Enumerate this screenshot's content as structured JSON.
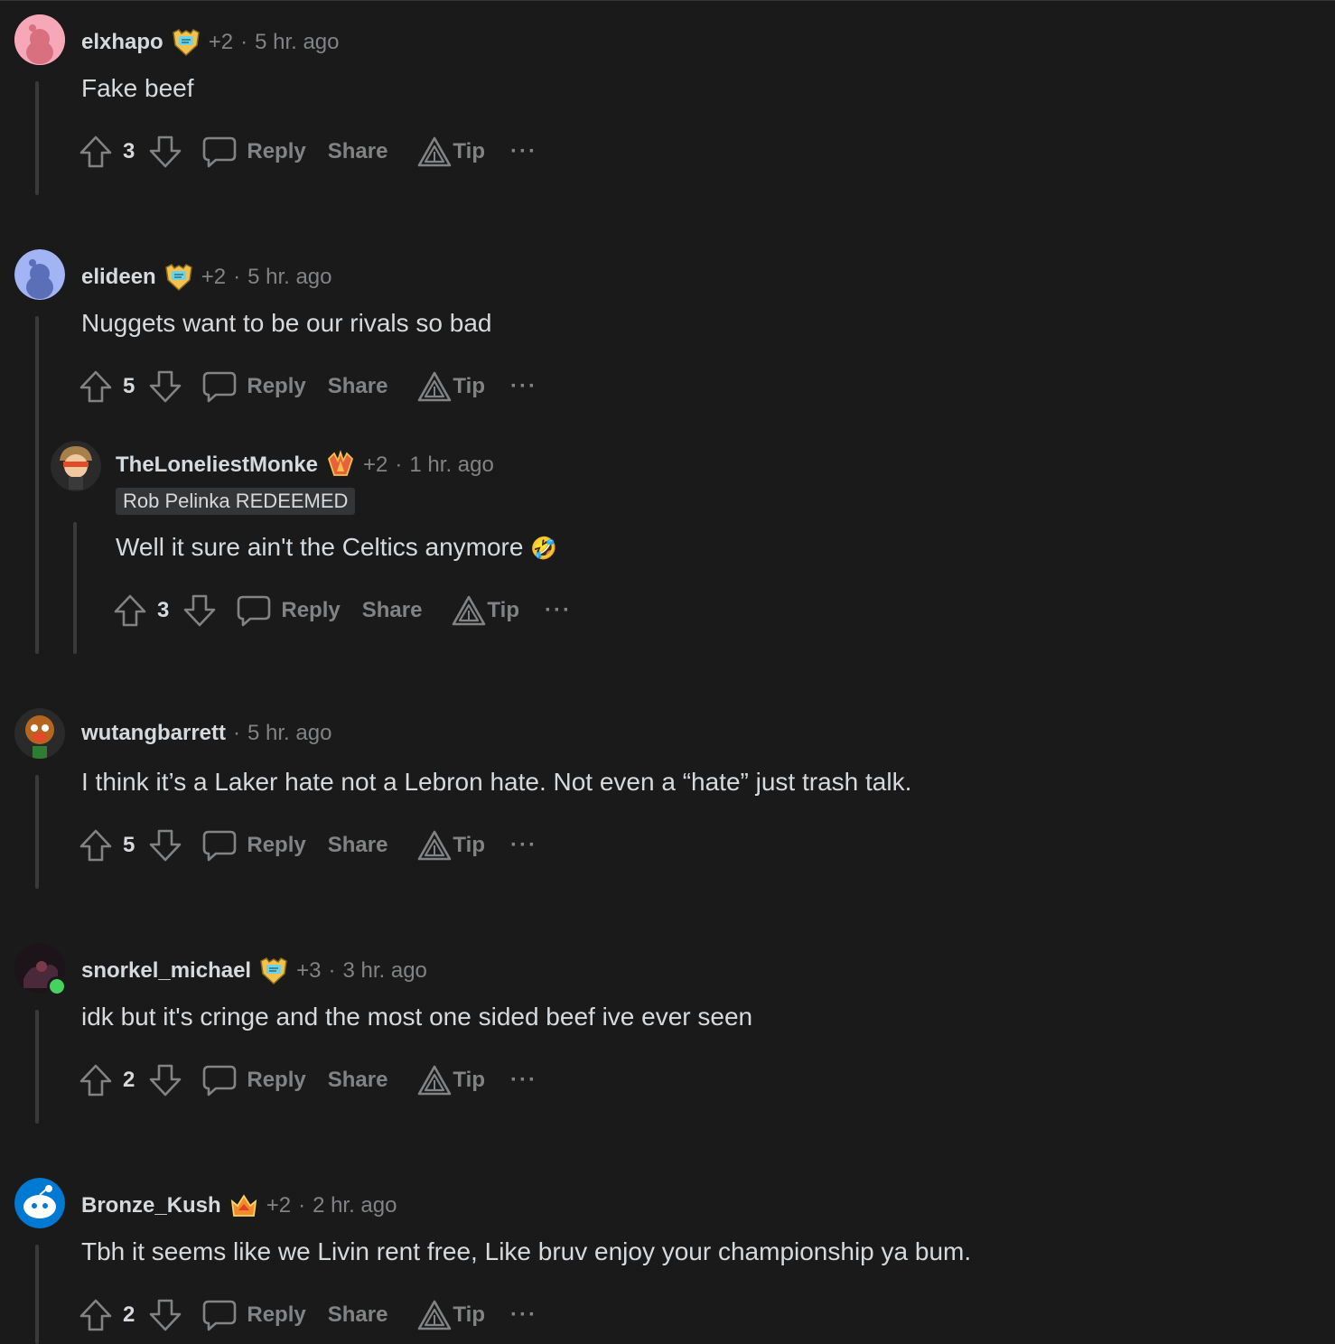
{
  "comments": [
    {
      "username": "elxhapo",
      "flair_icon": "shield-award-icon",
      "karma_delta": "+2",
      "separator": "·",
      "time": "5 hr. ago",
      "body": "Fake beef",
      "score": "3",
      "actions": {
        "reply": "Reply",
        "share": "Share",
        "tip": "Tip",
        "more": "···"
      },
      "avatar_color": "#f7a8b8"
    },
    {
      "username": "elideen",
      "flair_icon": "shield-award-icon",
      "karma_delta": "+2",
      "separator": "·",
      "time": "5 hr. ago",
      "body": "Nuggets want to be our rivals so bad",
      "score": "5",
      "actions": {
        "reply": "Reply",
        "share": "Share",
        "tip": "Tip",
        "more": "···"
      },
      "avatar_color": "#a3b4f5",
      "replies": [
        {
          "username": "TheLoneliestMonke",
          "flair_icon": "crystal-award-icon",
          "karma_delta": "+2",
          "separator": "·",
          "time": "1 hr. ago",
          "user_flair": "Rob Pelinka REDEEMED",
          "body": "Well it sure ain't the Celtics anymore",
          "emoji": "🤣",
          "score": "3",
          "actions": {
            "reply": "Reply",
            "share": "Share",
            "tip": "Tip",
            "more": "···"
          }
        }
      ]
    },
    {
      "username": "wutangbarrett",
      "separator": "·",
      "time": "5 hr. ago",
      "body": "I think it’s a Laker hate not a Lebron hate. Not even a “hate” just trash talk.",
      "score": "5",
      "actions": {
        "reply": "Reply",
        "share": "Share",
        "tip": "Tip",
        "more": "···"
      }
    },
    {
      "username": "snorkel_michael",
      "flair_icon": "shield-award-icon",
      "karma_delta": "+3",
      "separator": "·",
      "time": "3 hr. ago",
      "body": "idk but it's cringe and the most one sided beef ive ever seen",
      "score": "2",
      "actions": {
        "reply": "Reply",
        "share": "Share",
        "tip": "Tip",
        "more": "···"
      }
    },
    {
      "username": "Bronze_Kush",
      "flair_icon": "crown-award-icon",
      "karma_delta": "+2",
      "separator": "·",
      "time": "2 hr. ago",
      "body": "Tbh it seems like we Livin rent free, Like bruv enjoy your championship ya bum.",
      "score": "2",
      "actions": {
        "reply": "Reply",
        "share": "Share",
        "tip": "Tip",
        "more": "···"
      },
      "avatar_color": "#0079d3"
    }
  ],
  "colors": {
    "background": "#1a1a1b",
    "text": "#d7dadc",
    "muted": "#818384",
    "thread_line": "#3a3a3c",
    "online": "#46d160"
  }
}
